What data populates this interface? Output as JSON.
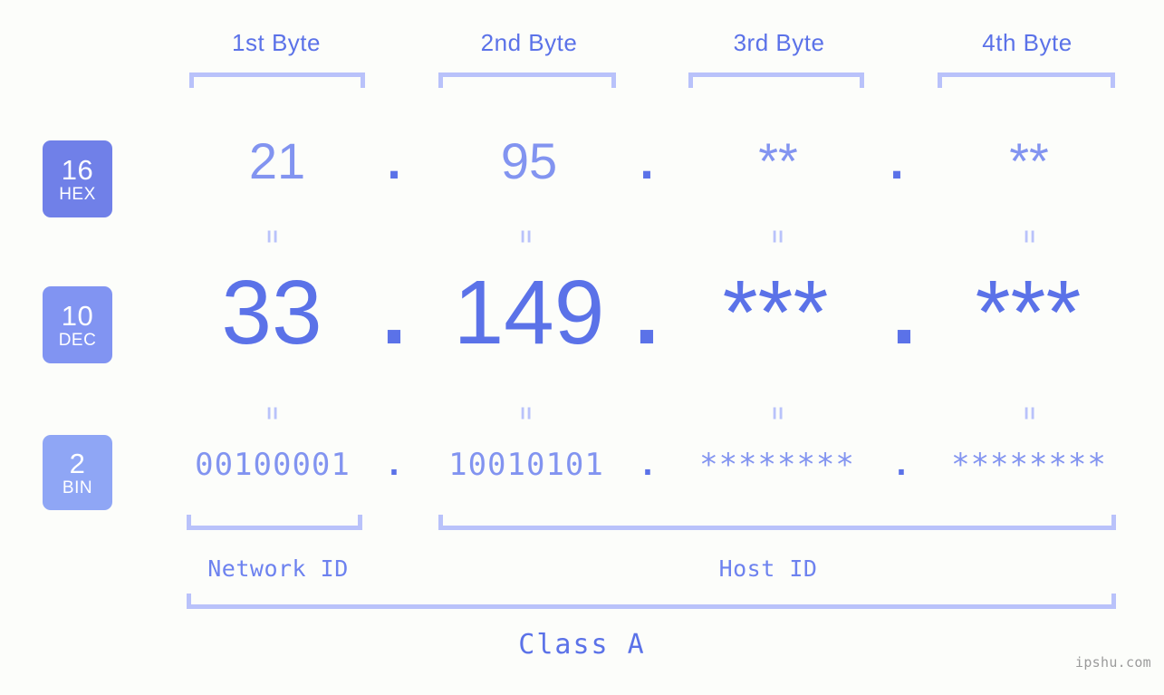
{
  "background_color": "#fcfdfa",
  "accent_colors": {
    "primary": "#5b72e8",
    "light": "#8294f0",
    "bracket": "#b9c2fa",
    "badge_hex": "#7080e8",
    "badge_dec": "#8194f2",
    "badge_bin": "#8fa6f5",
    "watermark": "#9b9b9b"
  },
  "byte_headers": [
    {
      "label": "1st Byte"
    },
    {
      "label": "2nd Byte"
    },
    {
      "label": "3rd Byte"
    },
    {
      "label": "4th Byte"
    }
  ],
  "radix_badges": [
    {
      "number": "16",
      "name": "HEX"
    },
    {
      "number": "10",
      "name": "DEC"
    },
    {
      "number": "2",
      "name": "BIN"
    }
  ],
  "rows": {
    "hex": {
      "radix": "16",
      "radix_name": "HEX",
      "values": [
        "21",
        "95",
        "**",
        "**"
      ],
      "separators": [
        ".",
        ".",
        "."
      ]
    },
    "dec": {
      "radix": "10",
      "radix_name": "DEC",
      "values": [
        "33",
        "149",
        "***",
        "***"
      ],
      "separators": [
        ".",
        ".",
        "."
      ]
    },
    "bin": {
      "radix": "2",
      "radix_name": "BIN",
      "values": [
        "00100001",
        "10010101",
        "********",
        "********"
      ],
      "separators": [
        ".",
        ".",
        "."
      ]
    }
  },
  "equals_separator": "=",
  "id_sections": [
    {
      "label": "Network ID"
    },
    {
      "label": "Host ID"
    }
  ],
  "class_label": "Class A",
  "watermark": "ipshu.com"
}
